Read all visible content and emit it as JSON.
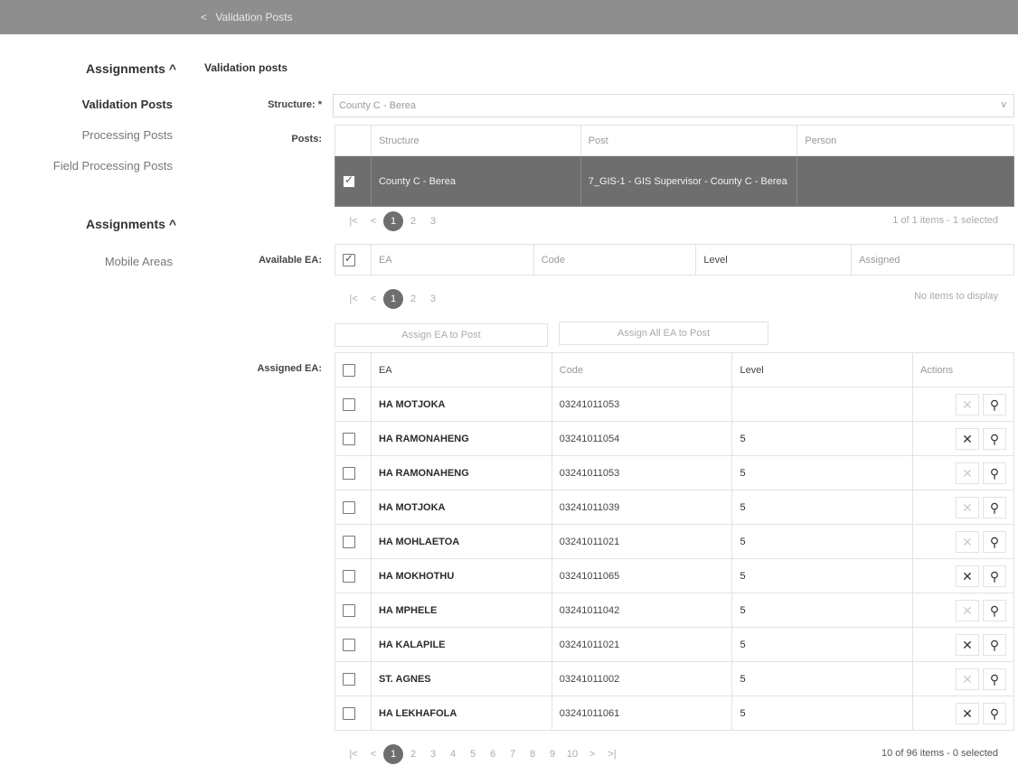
{
  "topbar": {
    "back_label": "Validation Posts"
  },
  "sidebar": {
    "sections": [
      {
        "title": "Assignments ^",
        "items": [
          "Validation Posts",
          "Processing Posts",
          "Field Processing Posts"
        ]
      },
      {
        "title": "Assignments ^",
        "items": [
          "Mobile Areas"
        ]
      }
    ]
  },
  "page": {
    "title": "Validation posts"
  },
  "structure": {
    "label": "Structure: *",
    "value": "County C - Berea"
  },
  "posts": {
    "label": "Posts:",
    "columns": [
      "Structure",
      "Post",
      "Person"
    ],
    "rows": [
      {
        "structure": "County C - Berea",
        "post": "7_GIS-1 - GIS Supervisor - County C - Berea",
        "person": "",
        "checked": true
      }
    ],
    "pagination": {
      "pages": [
        "1",
        "2",
        "3"
      ],
      "current": "1",
      "info": "1 of 1 items - 1 selected"
    }
  },
  "available": {
    "label": "Available EA:",
    "columns": [
      "EA",
      "Code",
      "Level",
      "Assigned"
    ],
    "pagination": {
      "pages": [
        "1",
        "2",
        "3"
      ],
      "current": "1",
      "info": "No items to display"
    },
    "assign_button": "Assign EA to Post",
    "assign_all_button": "Assign All EA to Post"
  },
  "assigned": {
    "label": "Assigned EA:",
    "columns": [
      "EA",
      "Code",
      "Level",
      "Actions"
    ],
    "rows": [
      {
        "ea": "HA MOTJOKA",
        "code": "03241011053",
        "level": "",
        "remove_enabled": false
      },
      {
        "ea": "HA RAMONAHENG",
        "code": "03241011054",
        "level": "5",
        "remove_enabled": true
      },
      {
        "ea": "HA RAMONAHENG",
        "code": "03241011053",
        "level": "5",
        "remove_enabled": false
      },
      {
        "ea": "HA MOTJOKA",
        "code": "03241011039",
        "level": "5",
        "remove_enabled": false
      },
      {
        "ea": "HA MOHLAETOA",
        "code": "03241011021",
        "level": "5",
        "remove_enabled": false
      },
      {
        "ea": "HA MOKHOTHU",
        "code": "03241011065",
        "level": "5",
        "remove_enabled": true
      },
      {
        "ea": "HA MPHELE",
        "code": "03241011042",
        "level": "5",
        "remove_enabled": false
      },
      {
        "ea": "HA KALAPILE",
        "code": "03241011021",
        "level": "5",
        "remove_enabled": true
      },
      {
        "ea": "ST. AGNES",
        "code": "03241011002",
        "level": "5",
        "remove_enabled": false
      },
      {
        "ea": "HA LEKHAFOLA",
        "code": "03241011061",
        "level": "5",
        "remove_enabled": true
      }
    ],
    "pagination": {
      "pages": [
        "1",
        "2",
        "3",
        "4",
        "5",
        "6",
        "7",
        "8",
        "9",
        "10"
      ],
      "current": "1",
      "info": "10 of 96 items - 0 selected"
    }
  },
  "icons": {
    "remove": "close-icon",
    "view": "search-icon",
    "prev": "chevron-left-icon",
    "first": "first-page-icon"
  }
}
